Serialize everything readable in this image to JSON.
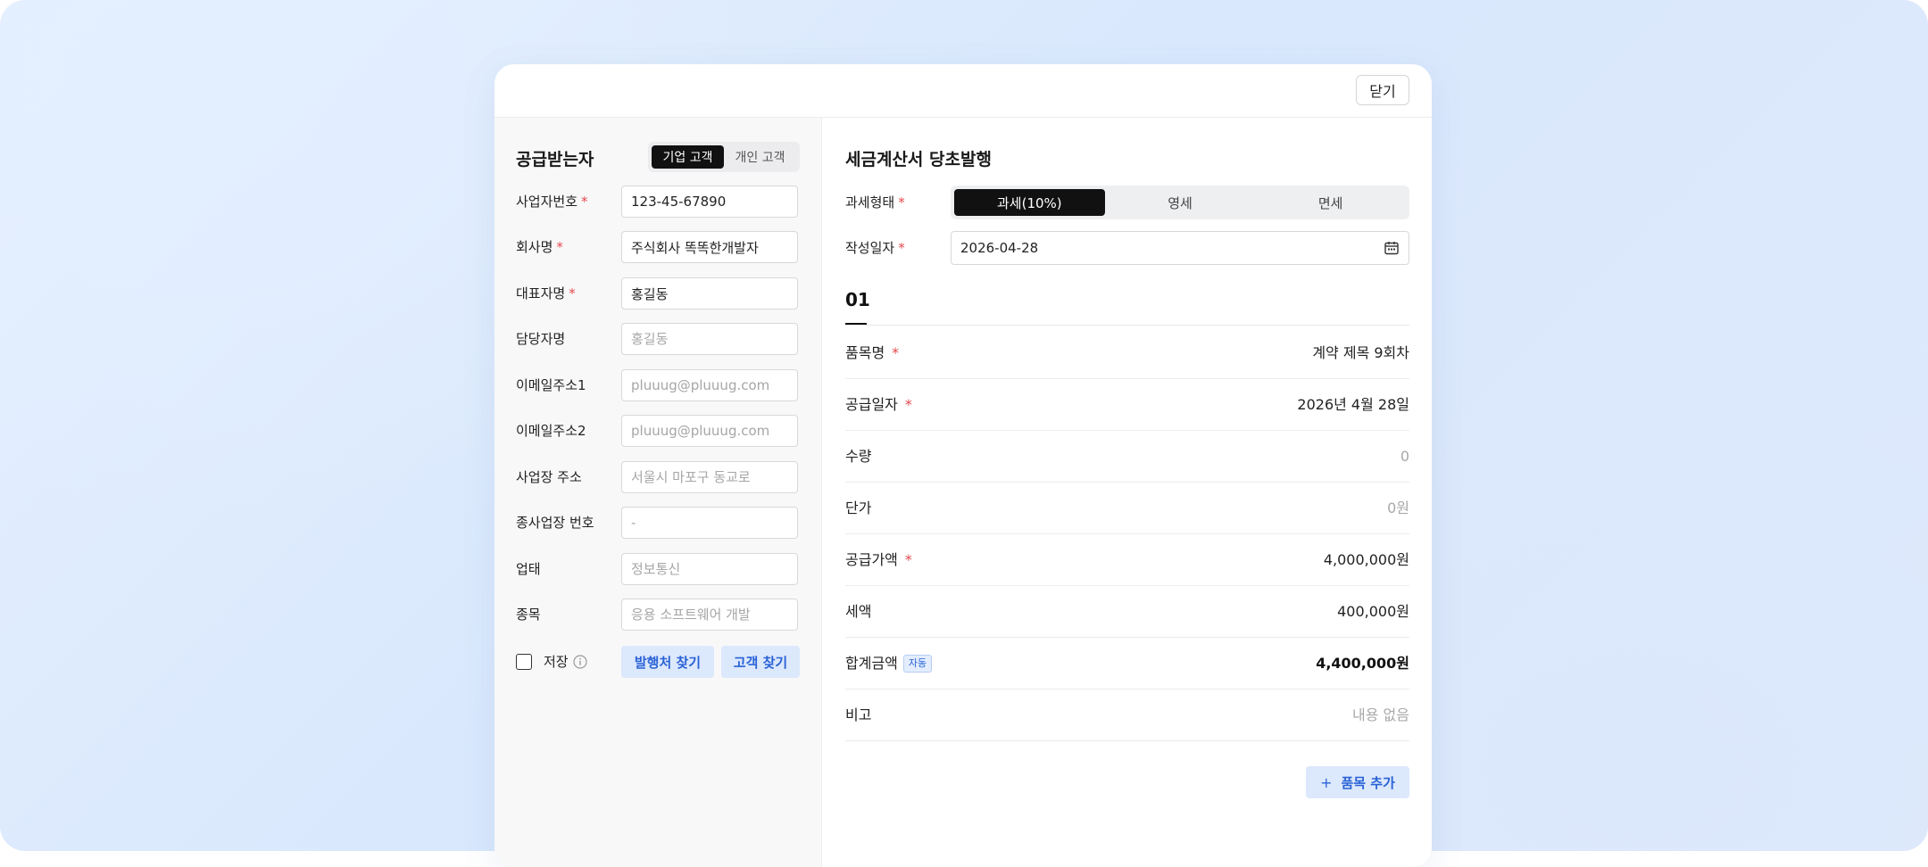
{
  "header": {
    "close_label": "닫기"
  },
  "recipient": {
    "title": "공급받는자",
    "customer_type": {
      "options": [
        "기업 고객",
        "개인 고객"
      ],
      "selected": "기업 고객"
    },
    "fields": [
      {
        "label": "사업자번호",
        "required": true,
        "value": "123-45-67890",
        "placeholder": ""
      },
      {
        "label": "회사명",
        "required": true,
        "value": "주식회사 똑똑한개발자",
        "placeholder": ""
      },
      {
        "label": "대표자명",
        "required": true,
        "value": "홍길동",
        "placeholder": ""
      },
      {
        "label": "담당자명",
        "required": false,
        "value": "",
        "placeholder": "홍길동"
      },
      {
        "label": "이메일주소1",
        "required": false,
        "value": "",
        "placeholder": "pluuug@pluuug.com"
      },
      {
        "label": "이메일주소2",
        "required": false,
        "value": "",
        "placeholder": "pluuug@pluuug.com"
      },
      {
        "label": "사업장 주소",
        "required": false,
        "value": "",
        "placeholder": "서울시 마포구 동교로"
      },
      {
        "label": "종사업장 번호",
        "required": false,
        "value": "",
        "placeholder": "-"
      },
      {
        "label": "업태",
        "required": false,
        "value": "",
        "placeholder": "정보통신"
      },
      {
        "label": "종목",
        "required": false,
        "value": "",
        "placeholder": "응용 소프트웨어 개발"
      }
    ],
    "save_label": "저장",
    "save_checked": false,
    "find_issuer_label": "발행처 찾기",
    "find_customer_label": "고객 찾기"
  },
  "invoice": {
    "title": "세금계산서 당초발행",
    "tax_type_label": "과세형태",
    "tax_type": {
      "options": [
        "과세(10%)",
        "영세",
        "면세"
      ],
      "selected": "과세(10%)"
    },
    "date_label": "작성일자",
    "date_value": "2026-04-28",
    "item_tab": "01",
    "item_fields": [
      {
        "label": "품목명",
        "required": true,
        "value": "계약 제목 9회차",
        "style": "normal"
      },
      {
        "label": "공급일자",
        "required": true,
        "value": "2026년 4월 28일",
        "style": "normal"
      },
      {
        "label": "수량",
        "required": false,
        "value": "0",
        "style": "muted"
      },
      {
        "label": "단가",
        "required": false,
        "value": "0원",
        "style": "muted"
      },
      {
        "label": "공급가액",
        "required": true,
        "value": "4,000,000원",
        "style": "normal"
      },
      {
        "label": "세액",
        "required": false,
        "value": "400,000원",
        "style": "normal"
      },
      {
        "label": "합계금액",
        "required": false,
        "value": "4,400,000원",
        "style": "bold",
        "badge": "자동"
      },
      {
        "label": "비고",
        "required": false,
        "value": "내용 없음",
        "style": "muted"
      }
    ],
    "add_item_label": "품목 추가",
    "required_mark": "*"
  },
  "colors": {
    "accent": "#2a63d6",
    "accent_bg": "#dce8fc",
    "required": "#e5484d",
    "active_segment": "#111111"
  },
  "icons": {
    "info": "info-circle-icon",
    "calendar": "calendar-icon",
    "plus": "plus-icon"
  }
}
